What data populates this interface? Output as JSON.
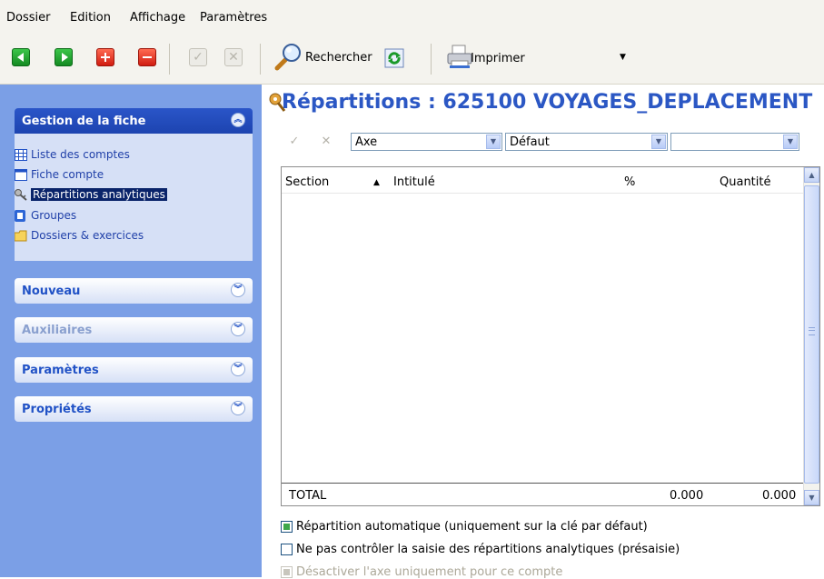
{
  "menu": [
    "Dossier",
    "Edition",
    "Affichage",
    "Paramètres"
  ],
  "toolbar": {
    "search_label": "Rechercher",
    "print_label": "Imprimer",
    "check_glyph": "✓",
    "cross_glyph": "✕"
  },
  "sidebar": {
    "gestion": {
      "title": "Gestion de la fiche",
      "items": [
        {
          "label": "Liste des comptes",
          "icon": "table-icon"
        },
        {
          "label": "Fiche compte",
          "icon": "form-icon"
        },
        {
          "label": "Répartitions analytiques",
          "icon": "key-icon",
          "selected": true
        },
        {
          "label": "Groupes",
          "icon": "group-icon"
        },
        {
          "label": "Dossiers & exercices",
          "icon": "folder-icon"
        }
      ]
    },
    "panels": [
      {
        "title": "Nouveau",
        "enabled": true
      },
      {
        "title": "Auxiliaires",
        "enabled": false
      },
      {
        "title": "Paramètres",
        "enabled": true
      },
      {
        "title": "Propriétés",
        "enabled": true
      }
    ]
  },
  "main": {
    "title": "Répartitions : 625100 VOYAGES_DEPLACEMENT",
    "filters": {
      "axe": "Axe",
      "defaut": "Défaut",
      "third": ""
    },
    "columns": {
      "section": "Section",
      "intitule": "Intitulé",
      "percent": "%",
      "quantite": "Quantité"
    },
    "total": {
      "label": "TOTAL",
      "percent": "0.000",
      "quantite": "0.000"
    },
    "options": [
      {
        "label": "Répartition automatique (uniquement sur la clé par défaut)",
        "checked": true,
        "disabled": false
      },
      {
        "label": "Ne pas contrôler la saisie des répartitions analytiques (présaisie)",
        "checked": false,
        "disabled": false
      },
      {
        "label": "Désactiver l'axe uniquement pour ce compte",
        "checked": true,
        "disabled": true
      }
    ]
  },
  "colors": {
    "accent": "#2b57c4",
    "sidebar_bg": "#7b9fe6",
    "selection": "#0a246a"
  }
}
